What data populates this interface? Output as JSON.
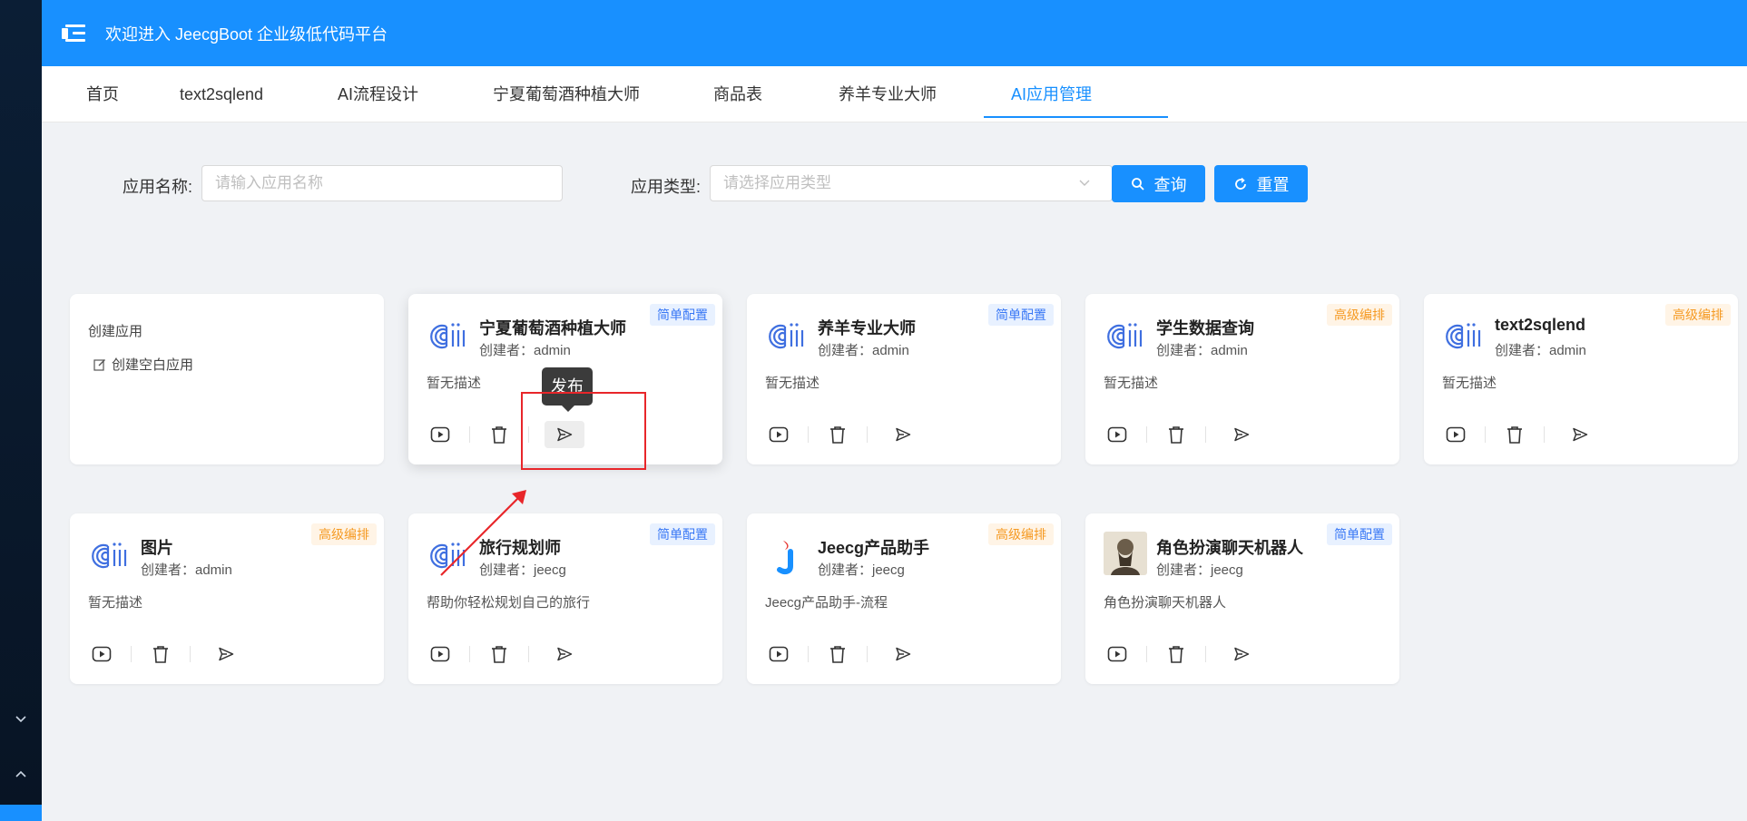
{
  "header": {
    "title": "欢迎进入 JeecgBoot 企业级低代码平台"
  },
  "tabs": [
    {
      "label": "首页",
      "active": false
    },
    {
      "label": "text2sqlend",
      "active": false
    },
    {
      "label": "AI流程设计",
      "active": false
    },
    {
      "label": "宁夏葡萄酒种植大师",
      "active": false
    },
    {
      "label": "商品表",
      "active": false
    },
    {
      "label": "养羊专业大师",
      "active": false
    },
    {
      "label": "AI应用管理",
      "active": true
    }
  ],
  "search": {
    "name_label": "应用名称:",
    "name_placeholder": "请输入应用名称",
    "type_label": "应用类型:",
    "type_placeholder": "请选择应用类型",
    "query_label": "查询",
    "reset_label": "重置"
  },
  "create_card": {
    "title": "创建应用",
    "blank_label": "创建空白应用"
  },
  "cards": [
    {
      "name": "宁夏葡萄酒种植大师",
      "creator": "创建者：admin",
      "desc": "暂无描述",
      "tag": "简单配置",
      "logo": "ai-logo"
    },
    {
      "name": "养羊专业大师",
      "creator": "创建者：admin",
      "desc": "暂无描述",
      "tag": "简单配置",
      "logo": "ai-logo"
    },
    {
      "name": "学生数据查询",
      "creator": "创建者：admin",
      "desc": "暂无描述",
      "tag": "高级编排",
      "logo": "ai-logo"
    },
    {
      "name": "text2sqlend",
      "creator": "创建者：admin",
      "desc": "暂无描述",
      "tag": "高级编排",
      "logo": "ai-logo"
    },
    {
      "name": "图片",
      "creator": "创建者：admin",
      "desc": "暂无描述",
      "tag": "高级编排",
      "logo": "ai-logo"
    },
    {
      "name": "旅行规划师",
      "creator": "创建者：jeecg",
      "desc": "帮助你轻松规划自己的旅行",
      "tag": "简单配置",
      "logo": "ai-logo"
    },
    {
      "name": "Jeecg产品助手",
      "creator": "创建者：jeecg",
      "desc": "Jeecg产品助手-流程",
      "tag": "高级编排",
      "logo": "jeecg-logo"
    },
    {
      "name": "角色扮演聊天机器人",
      "creator": "创建者：jeecg",
      "desc": "角色扮演聊天机器人",
      "tag": "简单配置",
      "logo": "portrait-avatar"
    }
  ],
  "tooltip": {
    "text": "发布"
  },
  "colors": {
    "primary": "#1890ff",
    "simple_tag": "#3978f5",
    "advanced_tag": "#f59a23",
    "annotation": "#e8262a"
  }
}
